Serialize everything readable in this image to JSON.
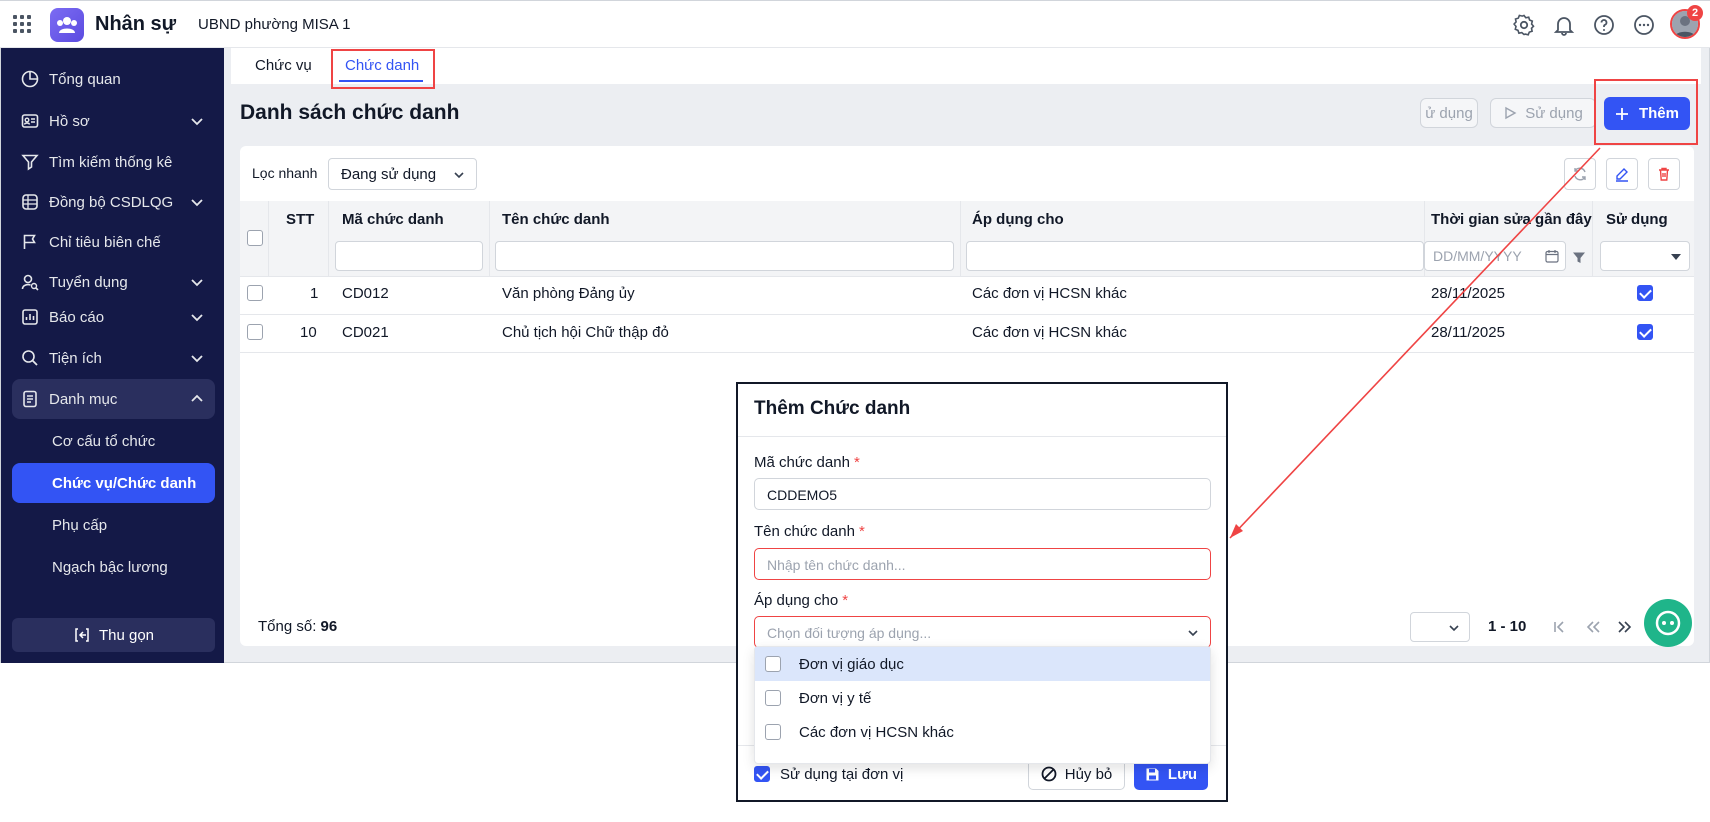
{
  "topbar": {
    "app_name": "Nhân sự",
    "org_name": "UBND phường MISA 1",
    "notification_count": "2"
  },
  "sidebar": {
    "items": [
      {
        "label": "Tổng quan",
        "icon": "pie-chart-icon"
      },
      {
        "label": "Hồ sơ",
        "icon": "id-card-icon"
      },
      {
        "label": "Tìm kiếm thống kê",
        "icon": "filter-icon"
      },
      {
        "label": "Đồng bộ CSDLQG",
        "icon": "database-icon"
      },
      {
        "label": "Chỉ tiêu biên chế",
        "icon": "flag-icon"
      },
      {
        "label": "Tuyển dụng",
        "icon": "user-search-icon"
      },
      {
        "label": "Báo cáo",
        "icon": "report-icon"
      },
      {
        "label": "Tiện ích",
        "icon": "search-icon"
      },
      {
        "label": "Danh mục",
        "icon": "document-icon"
      }
    ],
    "sub_items": [
      "Cơ cấu tổ chức",
      "Chức vụ/Chức danh",
      "Phụ cấp",
      "Ngạch bậc lương"
    ],
    "collapse_label": "Thu gọn"
  },
  "tabs": [
    "Chức vụ",
    "Chức danh"
  ],
  "page": {
    "title": "Danh sách chức danh",
    "btn_partial": "ử dụng",
    "btn_use": "Sử dụng",
    "btn_add": "Thêm"
  },
  "filter": {
    "label": "Lọc nhanh",
    "value": "Đang sử dụng"
  },
  "table": {
    "headers": [
      "STT",
      "Mã chức danh",
      "Tên chức danh",
      "Áp dụng cho",
      "Thời gian sửa gần đây",
      "Sử dụng"
    ],
    "date_placeholder": "DD/MM/YYYY",
    "rows": [
      {
        "stt": "1",
        "code": "CD012",
        "name": "Văn phòng Đảng ủy",
        "apply": "Các đơn vị HCSN khác",
        "time": "28/11/2025",
        "used": true
      },
      {
        "stt": "10",
        "code": "CD021",
        "name": "Chủ tịch hội Chữ thập đỏ",
        "apply": "Các đơn vị HCSN khác",
        "time": "28/11/2025",
        "used": true
      }
    ]
  },
  "footer": {
    "total_label": "Tổng số:",
    "total_value": "96",
    "range_label": "1 - 10"
  },
  "modal": {
    "title": "Thêm Chức danh",
    "code_label": "Mã chức danh",
    "code_value": "CDDEMO5",
    "name_label": "Tên chức danh",
    "name_placeholder": "Nhập tên chức danh...",
    "apply_label": "Áp dụng cho",
    "apply_placeholder": "Chọn đối tượng áp dụng...",
    "required_mark": "*",
    "options": [
      "Đơn vị giáo dục",
      "Đơn vị y tế",
      "Các đơn vị HCSN khác"
    ],
    "use_at_unit_label": "Sử dụng tại đơn vị",
    "cancel_label": "Hủy bỏ",
    "save_label": "Lưu"
  },
  "colors": {
    "primary": "#3354f4",
    "sidebar_bg": "#141947",
    "annotation_red": "#ef4444",
    "chat_green": "#1fb58a"
  }
}
